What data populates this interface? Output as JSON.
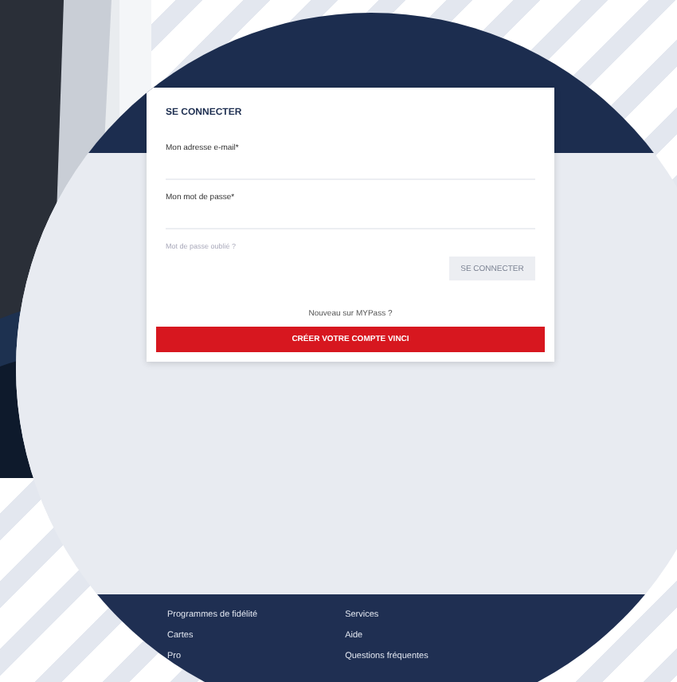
{
  "login": {
    "title": "SE CONNECTER",
    "fields": [
      {
        "label": "Mon adresse e-mail*"
      },
      {
        "label": "Mon mot de passe*"
      }
    ],
    "forgot_link": "Mot de passe oublié ?",
    "submit_button": {
      "label": "SE CONNECTER",
      "disabled": true
    },
    "signup_prompt": "Nouveau sur MYPass ?",
    "signup_button": "CRÉER VOTRE COMPTE VINCI"
  },
  "footer": {
    "columns": [
      [
        "Programmes de fidélité",
        "Cartes",
        "Pro"
      ],
      [
        "Services",
        "Aide",
        "Questions fréquentes"
      ]
    ]
  }
}
